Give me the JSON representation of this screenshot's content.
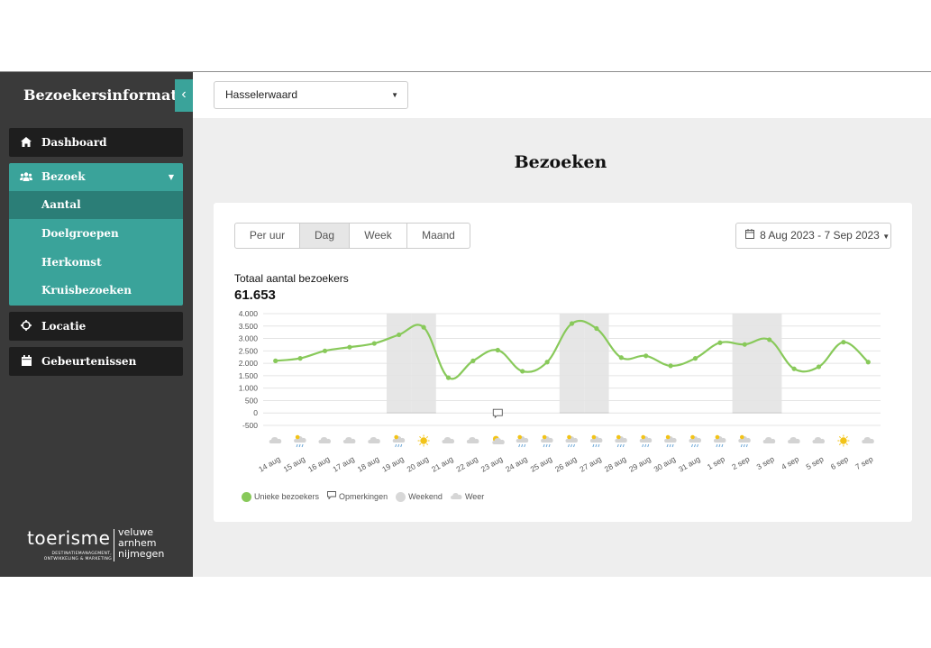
{
  "sidebar": {
    "title": "Bezoekersinformatie",
    "collapse_icon": "chevron-left-icon",
    "items": [
      {
        "label": "Dashboard",
        "icon": "home-icon"
      },
      {
        "label": "Bezoek",
        "icon": "users-icon"
      },
      {
        "label": "Locatie",
        "icon": "crosshair-icon"
      },
      {
        "label": "Gebeurtenissen",
        "icon": "calendar-icon"
      }
    ],
    "subitems": [
      "Aantal",
      "Doelgroepen",
      "Herkomst",
      "Kruisbezoeken"
    ],
    "active_subitem": "Aantal",
    "logo": {
      "main": "toerisme",
      "sub_line1": "DESTINATIEMANAGEMENT,",
      "sub_line2": "ONTWIKKELING & MARKETING",
      "region_1": "veluwe",
      "region_2": "arnhem",
      "region_3": "nijmegen"
    }
  },
  "topbar": {
    "location": "Hasselerwaard"
  },
  "page": {
    "title": "Bezoeken"
  },
  "card": {
    "tabs": [
      "Per uur",
      "Dag",
      "Week",
      "Maand"
    ],
    "active_tab": "Dag",
    "date_range": "8 Aug 2023 - 7 Sep 2023",
    "total_label": "Totaal aantal bezoekers",
    "total_value": "61.653"
  },
  "chart_data": {
    "type": "line",
    "x": [
      "14 aug",
      "15 aug",
      "16 aug",
      "17 aug",
      "18 aug",
      "19 aug",
      "20 aug",
      "21 aug",
      "22 aug",
      "23 aug",
      "24 aug",
      "25 aug",
      "26 aug",
      "27 aug",
      "28 aug",
      "29 aug",
      "30 aug",
      "31 aug",
      "1 sep",
      "2 sep",
      "3 sep",
      "4 sep",
      "5 sep",
      "6 sep",
      "7 sep"
    ],
    "series": [
      {
        "name": "Unieke bezoekers",
        "color": "#88c95a",
        "values": [
          2100,
          2200,
          2500,
          2650,
          2800,
          3150,
          3450,
          1420,
          2100,
          2530,
          1680,
          2050,
          3600,
          3400,
          2230,
          2300,
          1900,
          2200,
          2830,
          2760,
          2950,
          1780,
          1860,
          2850,
          2050
        ]
      }
    ],
    "weekend_days": [
      "19 aug",
      "20 aug",
      "26 aug",
      "27 aug",
      "2 sep",
      "3 sep"
    ],
    "remark_days": [
      "23 aug"
    ],
    "weather": [
      "cloud",
      "rain",
      "cloud",
      "cloud",
      "cloud",
      "rain",
      "sun",
      "cloud",
      "cloud",
      "sun-cloud",
      "rain",
      "rain",
      "rain",
      "rain",
      "rain",
      "rain",
      "rain",
      "rain",
      "rain",
      "rain",
      "cloud",
      "cloud",
      "cloud",
      "sun",
      "cloud"
    ],
    "ylim": [
      -500,
      4000
    ],
    "yticks": [
      "4.000",
      "3.500",
      "3.000",
      "2.500",
      "2.000",
      "1.500",
      "1.000",
      "500",
      "0",
      "-500"
    ],
    "grid": true,
    "legend_position": "bottom-left",
    "legend": [
      "Unieke bezoekers",
      "Opmerkingen",
      "Weekend",
      "Weer"
    ]
  },
  "colors": {
    "teal": "#3aa39a",
    "teal_dark": "#2b7e77",
    "sidebar": "#3a3a3a",
    "line": "#88c95a",
    "weekend_band": "#e6e6e6"
  }
}
